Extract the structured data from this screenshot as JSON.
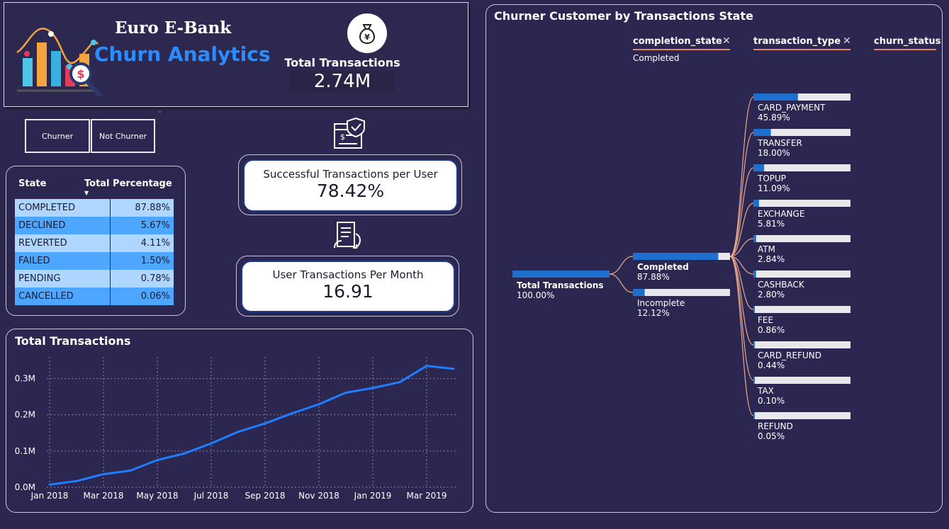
{
  "header": {
    "title_line1": "Euro E-Bank",
    "title_line2": "Churn Analytics",
    "total_transactions_label": "Total Transactions",
    "total_transactions_value": "2.74M"
  },
  "slicer": {
    "options": [
      "Churner",
      "Not Churner"
    ]
  },
  "state_table": {
    "col_state": "State",
    "col_pct": "Total Percentage",
    "rows": [
      {
        "state": "COMPLETED",
        "pct": "87.88%"
      },
      {
        "state": "DECLINED",
        "pct": "5.67%"
      },
      {
        "state": "REVERTED",
        "pct": "4.11%"
      },
      {
        "state": "FAILED",
        "pct": "1.50%"
      },
      {
        "state": "PENDING",
        "pct": "0.78%"
      },
      {
        "state": "CANCELLED",
        "pct": "0.06%"
      }
    ]
  },
  "kpi_success": {
    "label": "Successful Transactions per User",
    "value": "78.42%"
  },
  "kpi_monthly": {
    "label": "User Transactions Per Month",
    "value": "16.91"
  },
  "line_chart": {
    "title": "Total Transactions"
  },
  "chart_data": {
    "type": "line",
    "title": "Total Transactions",
    "x": [
      "Jan 2018",
      "Feb 2018",
      "Mar 2018",
      "Apr 2018",
      "May 2018",
      "Jun 2018",
      "Jul 2018",
      "Aug 2018",
      "Sep 2018",
      "Oct 2018",
      "Nov 2018",
      "Dec 2018",
      "Jan 2019",
      "Feb 2019",
      "Mar 2019",
      "Apr 2019"
    ],
    "x_tick_labels": [
      "Jan 2018",
      "Mar 2018",
      "May 2018",
      "Jul 2018",
      "Sep 2018",
      "Nov 2018",
      "Jan 2019",
      "Mar 2019"
    ],
    "y_tick_labels": [
      "0.0M",
      "0.1M",
      "0.2M",
      "0.3M"
    ],
    "ylim": [
      0,
      0.35
    ],
    "y_unit": "M",
    "values": [
      0.007,
      0.017,
      0.036,
      0.046,
      0.075,
      0.093,
      0.121,
      0.153,
      0.176,
      0.204,
      0.229,
      0.261,
      0.274,
      0.29,
      0.335,
      0.327
    ],
    "grid": true,
    "color": "#1f7dff"
  },
  "decomposition": {
    "title": "Churner Customer by Transactions State",
    "headers": [
      {
        "label": "completion_state",
        "selected": "Completed"
      },
      {
        "label": "transaction_type"
      },
      {
        "label": "churn_status"
      }
    ],
    "root": {
      "label": "Total Transactions",
      "pct": "100.00%",
      "fraction": 1.0
    },
    "level1": [
      {
        "label": "Completed",
        "pct": "87.88%",
        "fraction": 0.8788
      },
      {
        "label": "Incomplete",
        "pct": "12.12%",
        "fraction": 0.1212
      }
    ],
    "level2": [
      {
        "label": "CARD_PAYMENT",
        "pct": "45.89%",
        "fraction": 0.4589
      },
      {
        "label": "TRANSFER",
        "pct": "18.00%",
        "fraction": 0.18
      },
      {
        "label": "TOPUP",
        "pct": "11.09%",
        "fraction": 0.1109
      },
      {
        "label": "EXCHANGE",
        "pct": "5.81%",
        "fraction": 0.0581
      },
      {
        "label": "ATM",
        "pct": "2.84%",
        "fraction": 0.0284
      },
      {
        "label": "CASHBACK",
        "pct": "2.80%",
        "fraction": 0.028
      },
      {
        "label": "FEE",
        "pct": "0.86%",
        "fraction": 0.0086
      },
      {
        "label": "CARD_REFUND",
        "pct": "0.44%",
        "fraction": 0.0044
      },
      {
        "label": "TAX",
        "pct": "0.10%",
        "fraction": 0.001
      },
      {
        "label": "REFUND",
        "pct": "0.05%",
        "fraction": 0.0005
      }
    ]
  },
  "icons": {
    "logo": "analytics-chart-magnifier-icon",
    "kpi_total": "money-bag-yen-icon",
    "kpi_success": "secure-invoice-check-icon",
    "kpi_monthly": "transaction-receipt-exchange-icon",
    "close": "close-icon"
  },
  "colors": {
    "background": "#2c2750",
    "accent_blue": "#2a8cff",
    "bar_blue": "#1f6fce",
    "bar_track": "#e8e8ec",
    "connector": "#e8a98f",
    "table_light": "#aed6ff",
    "table_dark": "#4da6ff"
  }
}
